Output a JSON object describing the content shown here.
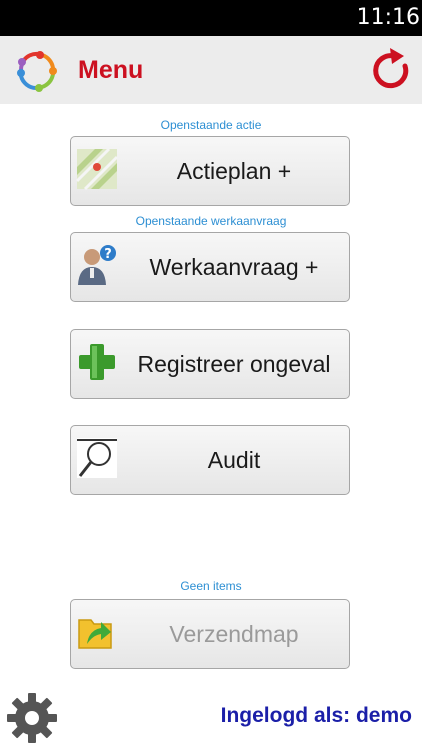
{
  "status_bar": {
    "time": "11:16"
  },
  "app_bar": {
    "title": "Menu",
    "logo_icon": "app-logo-icon",
    "refresh_icon": "refresh-icon",
    "title_color": "#cc1020"
  },
  "menu": [
    {
      "caption": "Openstaande actie",
      "label": "Actieplan +",
      "icon": "map-icon",
      "enabled": true
    },
    {
      "caption": "Openstaande werkaanvraag",
      "label": "Werkaanvraag +",
      "icon": "person-question-icon",
      "enabled": true
    },
    {
      "caption": "",
      "label": "Registreer ongeval",
      "icon": "plus-icon",
      "enabled": true
    },
    {
      "caption": "",
      "label": "Audit",
      "icon": "magnifier-icon",
      "enabled": true
    },
    {
      "caption": "Geen items",
      "label": "Verzendmap",
      "icon": "folder-arrow-icon",
      "enabled": false
    }
  ],
  "footer": {
    "login_text": "Ingelogd als: demo",
    "settings_icon": "gear-icon",
    "accent_color": "#2d8fd3"
  }
}
